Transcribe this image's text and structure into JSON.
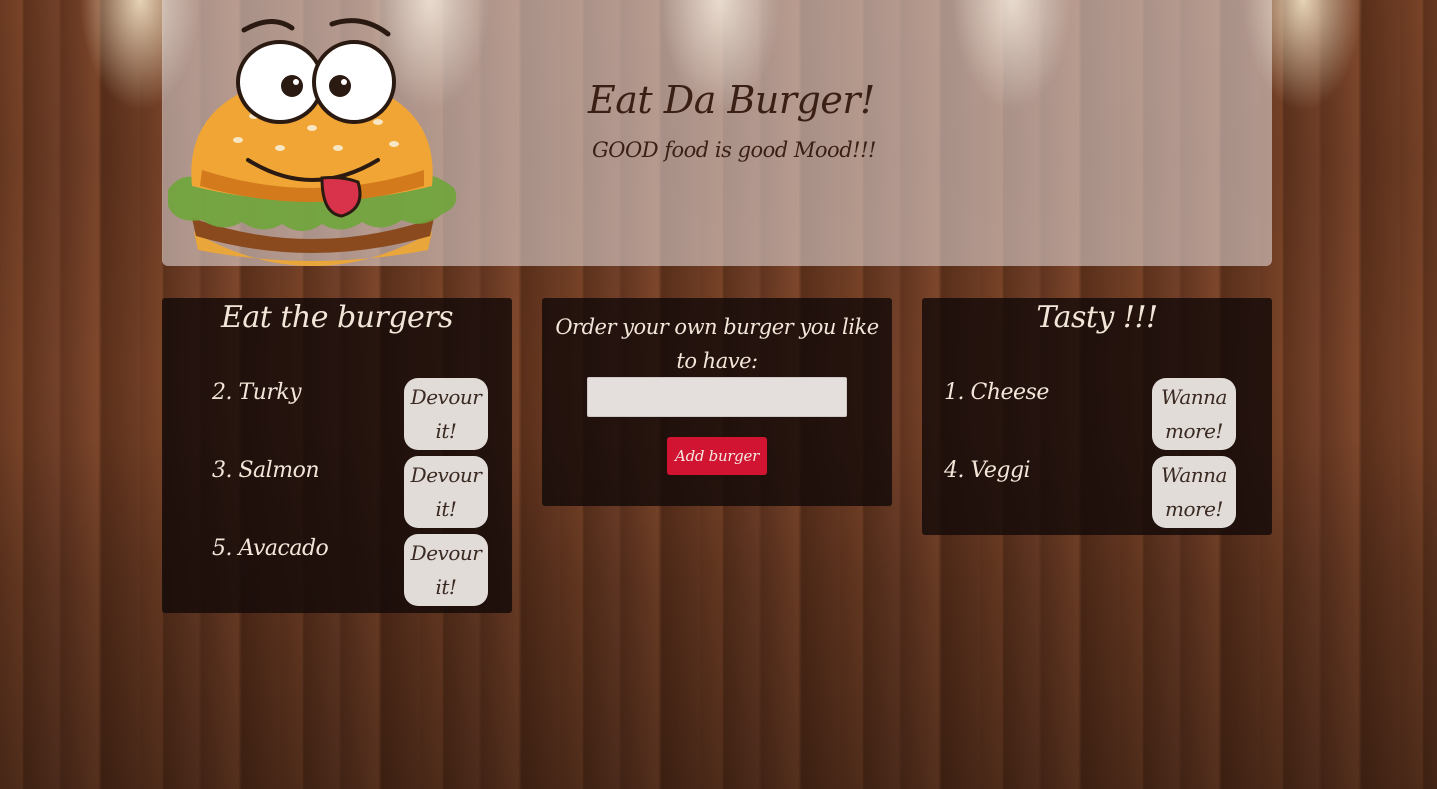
{
  "header": {
    "title": "Eat Da Burger!",
    "subtitle": "GOOD food is good Mood!!!",
    "logo_icon": "burger-mascot-icon"
  },
  "left_panel": {
    "heading": "Eat the burgers",
    "items": [
      {
        "label": "2. Turky",
        "button": "Devour it!"
      },
      {
        "label": "3. Salmon",
        "button": "Devour it!"
      },
      {
        "label": "5. Avacado",
        "button": "Devour it!"
      }
    ]
  },
  "order_panel": {
    "label": "Order your own burger you like to have:",
    "input_value": "",
    "button": "Add burger"
  },
  "right_panel": {
    "heading": "Tasty !!!",
    "items": [
      {
        "label": "1. Cheese",
        "button": "Wanna more!"
      },
      {
        "label": "4. Veggi",
        "button": "Wanna more!"
      }
    ]
  },
  "colors": {
    "accent_button": "#d01432",
    "panel_bg": "#140a08",
    "header_text": "#3a1f14"
  }
}
